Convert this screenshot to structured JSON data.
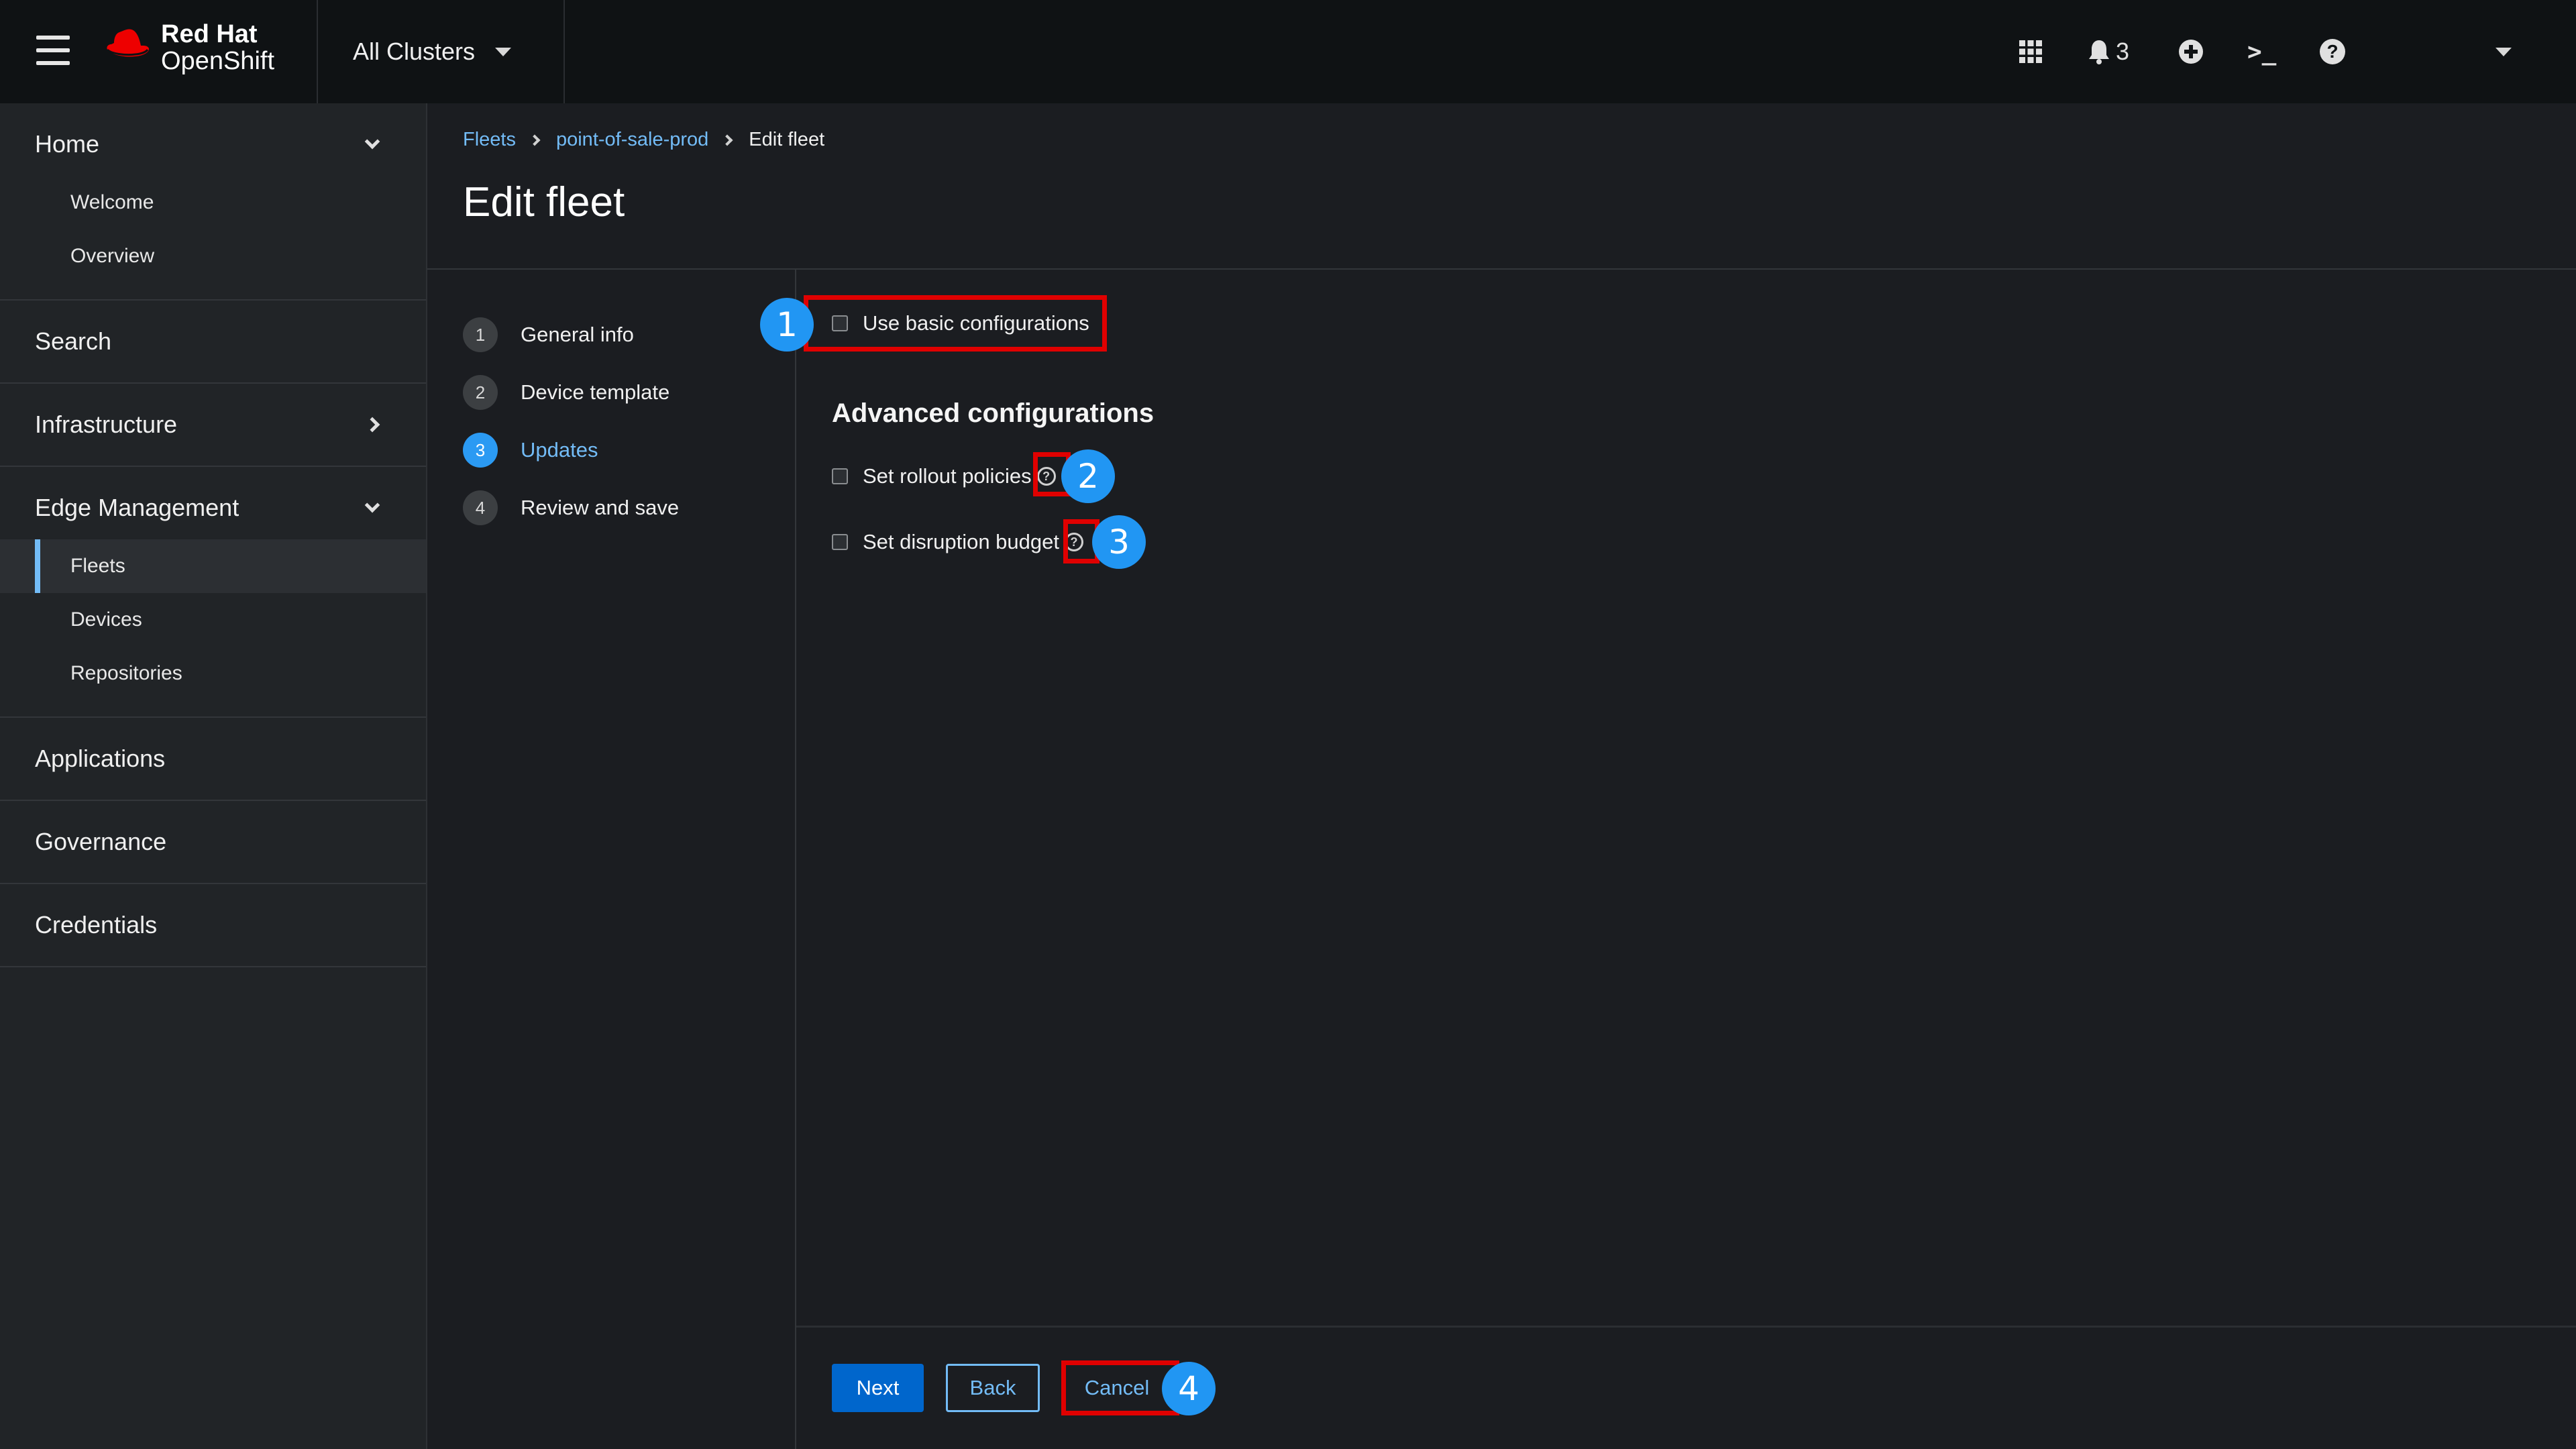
{
  "masthead": {
    "brand_line1": "Red Hat",
    "brand_line2": "OpenShift",
    "cluster_selector": "All Clusters",
    "notification_count": "3",
    "terminal_glyph": ">_",
    "help_glyph": "?"
  },
  "sidebar": {
    "sections": [
      {
        "label": "Home",
        "expanded": true,
        "items": [
          {
            "label": "Welcome"
          },
          {
            "label": "Overview"
          }
        ]
      },
      {
        "label": "Search"
      },
      {
        "label": "Infrastructure",
        "expanded": false
      },
      {
        "label": "Edge Management",
        "expanded": true,
        "items": [
          {
            "label": "Fleets",
            "active": true
          },
          {
            "label": "Devices"
          },
          {
            "label": "Repositories"
          }
        ]
      },
      {
        "label": "Applications"
      },
      {
        "label": "Governance"
      },
      {
        "label": "Credentials"
      }
    ]
  },
  "breadcrumb": {
    "items": [
      "Fleets",
      "point-of-sale-prod",
      "Edit fleet"
    ]
  },
  "page": {
    "title": "Edit fleet"
  },
  "wizard": {
    "steps": [
      {
        "num": "1",
        "label": "General info"
      },
      {
        "num": "2",
        "label": "Device template"
      },
      {
        "num": "3",
        "label": "Updates",
        "current": true
      },
      {
        "num": "4",
        "label": "Review and save"
      }
    ]
  },
  "form": {
    "basic_config_label": "Use basic configurations",
    "advanced_title": "Advanced configurations",
    "rollout_label": "Set rollout policies",
    "disruption_label": "Set disruption budget",
    "help_glyph": "?"
  },
  "footer": {
    "next_label": "Next",
    "back_label": "Back",
    "cancel_label": "Cancel"
  },
  "annotations": {
    "badges": [
      "1",
      "2",
      "3",
      "4"
    ],
    "badge_color": "#2196f3",
    "highlight_color": "#e00000"
  },
  "colors": {
    "masthead_bg": "#0f1214",
    "page_bg": "#1b1d21",
    "sidebar_bg": "#212427",
    "link": "#73bcf7",
    "primary": "#0066cc"
  }
}
